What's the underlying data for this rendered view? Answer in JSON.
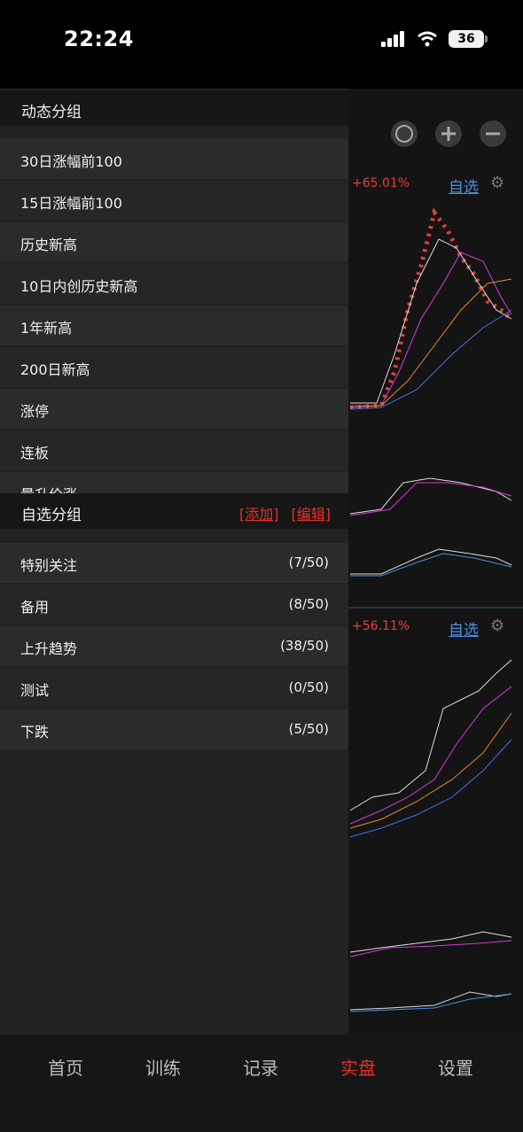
{
  "status": {
    "time": "22:24",
    "battery": "36"
  },
  "background": {
    "stocks": [
      {
        "change": "+65.01%",
        "watch_label": "自选"
      },
      {
        "change": "+56.11%",
        "watch_label": "自选"
      }
    ]
  },
  "drawer": {
    "dynamic_title": "动态分组",
    "dynamic_items": [
      "30日涨幅前100",
      "15日涨幅前100",
      "历史新高",
      "10日内创历史新高",
      "1年新高",
      "200日新高",
      "涨停",
      "连板",
      "量升价涨"
    ],
    "custom_title": "自选分组",
    "add_label": "[添加]",
    "edit_label": "[编辑]",
    "custom_items": [
      {
        "label": "特别关注",
        "count": "(7/50)"
      },
      {
        "label": "备用",
        "count": "(8/50)"
      },
      {
        "label": "上升趋势",
        "count": "(38/50)"
      },
      {
        "label": "测试",
        "count": "(0/50)"
      },
      {
        "label": "下跌",
        "count": "(5/50)"
      }
    ]
  },
  "tabs": [
    "首页",
    "训练",
    "记录",
    "实盘",
    "设置"
  ],
  "active_tab": "实盘",
  "colors": {
    "accent": "#e4322b",
    "link": "#4a90e2",
    "up": "#e0403c",
    "down": "#1f8a5c"
  }
}
